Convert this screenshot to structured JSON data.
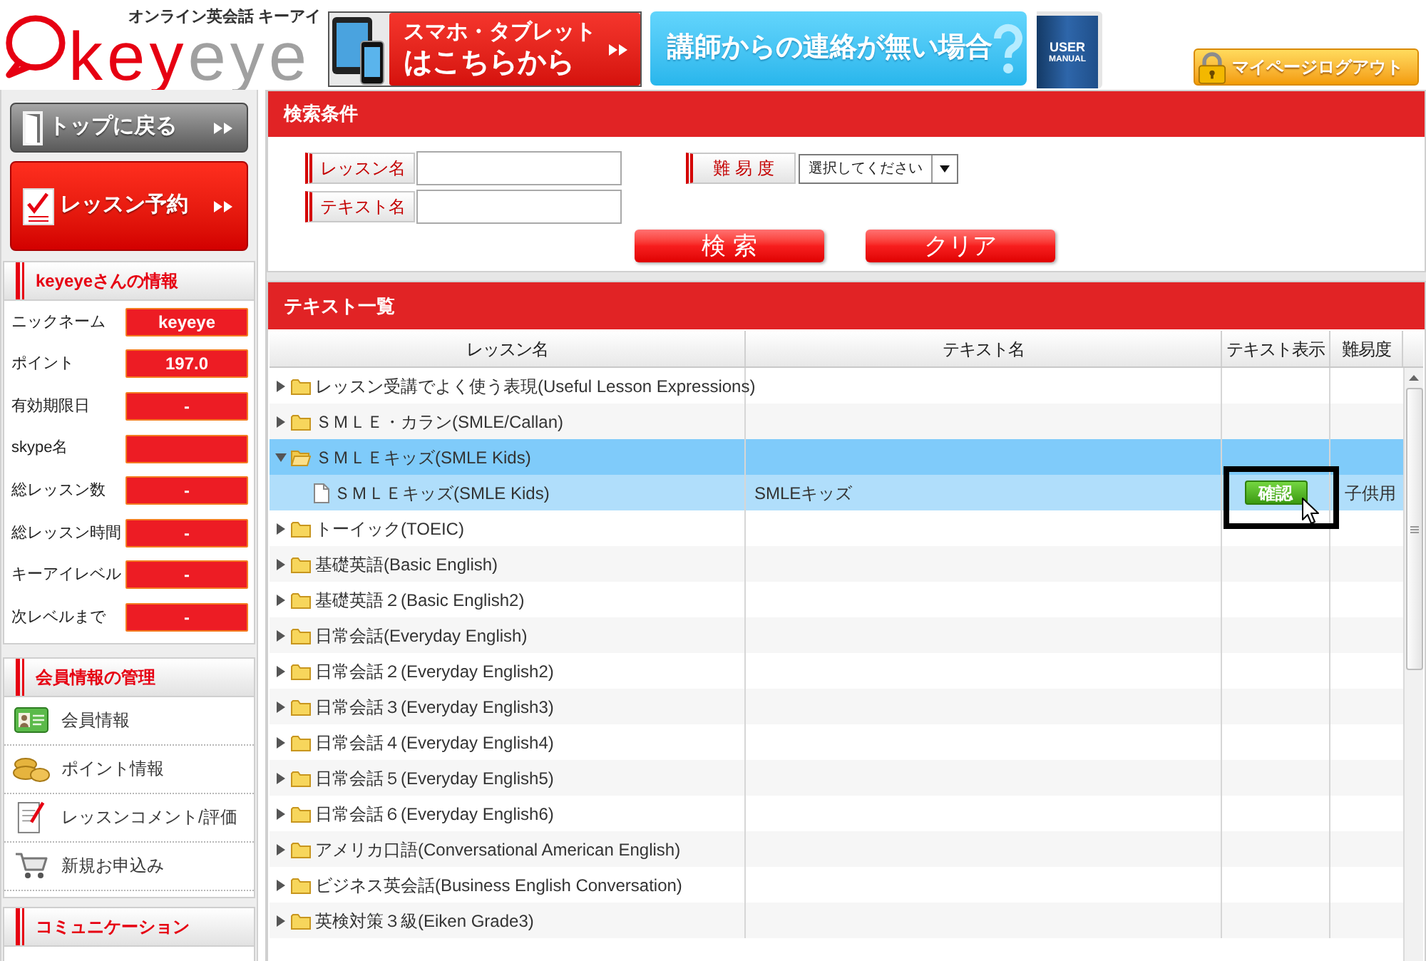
{
  "header": {
    "logo": {
      "tagline": "オンライン英会話 キーアイ",
      "wordmark": [
        "key",
        "eye"
      ]
    },
    "banners": [
      {
        "kind": "devices",
        "lines": [
          "スマホ・タブレット",
          "はこちらから"
        ]
      },
      {
        "kind": "question",
        "lines": [
          "講師からの連絡が無い場合"
        ]
      },
      {
        "kind": "manual",
        "lines": [
          "USER",
          "MANUAL"
        ]
      }
    ],
    "logout": "マイページログアウト"
  },
  "sidebar": {
    "nav": [
      {
        "kind": "top",
        "label": "トップに戻る"
      },
      {
        "kind": "reserve",
        "label": "レッスン予約"
      }
    ],
    "profile": {
      "title": "keyeyeさんの情報",
      "fields": [
        {
          "label": "ニックネーム",
          "value": "keyeye"
        },
        {
          "label": "ポイント",
          "value": "197.0"
        },
        {
          "label": "有効期限日",
          "value": "-"
        },
        {
          "label": "skype名"
        },
        {
          "label": "総レッスン数",
          "value": "-"
        },
        {
          "label": "総レッスン時間",
          "value": "-"
        },
        {
          "label": "キーアイレベル",
          "value": "-"
        },
        {
          "label": "次レベルまで",
          "value": "-"
        }
      ]
    },
    "member": {
      "title": "会員情報の管理",
      "items": [
        {
          "kind": "card",
          "label": "会員情報"
        },
        {
          "kind": "coins",
          "label": "ポイント情報"
        },
        {
          "kind": "memo",
          "label": "レッスンコメント/評価"
        },
        {
          "kind": "cart",
          "label": "新規お申込み"
        }
      ]
    },
    "communication": {
      "title": "コミュニケーション"
    }
  },
  "search": {
    "title": "検索条件",
    "fields": [
      {
        "label": "レッスン名"
      },
      {
        "label": "テキスト名"
      }
    ],
    "difficulty": {
      "label": "難 易 度",
      "value": "選択してください"
    },
    "buttons": [
      "検 索",
      "クリア"
    ]
  },
  "table": {
    "title": "テキスト一覧",
    "columns": [
      "レッスン名",
      "テキスト名",
      "テキスト表示",
      "難易度"
    ],
    "rows": [
      {
        "name": "レッスン受講でよく使う表現(Useful Lesson Expressions)",
        "expanded": false,
        "selected": false
      },
      {
        "name": "ＳＭＬＥ・カラン(SMLE/Callan)",
        "expanded": false,
        "selected": false
      },
      {
        "name": "ＳＭＬＥキッズ(SMLE Kids)",
        "expanded": true,
        "selected": true,
        "children": [
          {
            "name": "ＳＭＬＥキッズ(SMLE Kids)",
            "text_name": "SMLEキッズ",
            "action": "確認",
            "difficulty": "子供用",
            "selected": false,
            "hovered": true,
            "framed": true
          }
        ]
      },
      {
        "name": "トーイック(TOEIC)",
        "expanded": false,
        "selected": false
      },
      {
        "name": "基礎英語(Basic English)",
        "expanded": false,
        "selected": false
      },
      {
        "name": "基礎英語２(Basic English2)",
        "expanded": false,
        "selected": false
      },
      {
        "name": "日常会話(Everyday English)",
        "expanded": false,
        "selected": false
      },
      {
        "name": "日常会話２(Everyday English2)",
        "expanded": false,
        "selected": false
      },
      {
        "name": "日常会話３(Everyday English3)",
        "expanded": false,
        "selected": false
      },
      {
        "name": "日常会話４(Everyday English4)",
        "expanded": false,
        "selected": false
      },
      {
        "name": "日常会話５(Everyday English5)",
        "expanded": false,
        "selected": false
      },
      {
        "name": "日常会話６(Everyday English6)",
        "expanded": false,
        "selected": false
      },
      {
        "name": "アメリカ口語(Conversational American English)",
        "expanded": false,
        "selected": false
      },
      {
        "name": "ビジネス英会話(Business English Conversation)",
        "expanded": false,
        "selected": false
      },
      {
        "name": "英検対策３級(Eiken Grade3)",
        "expanded": false,
        "selected": false
      }
    ]
  }
}
